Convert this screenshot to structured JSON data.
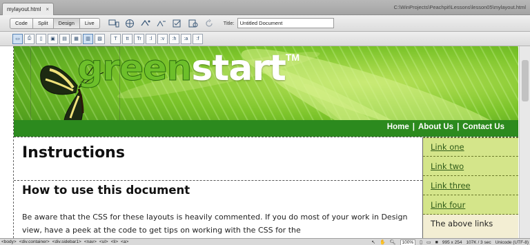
{
  "tab": {
    "filename": "mylayout.html",
    "close": "×"
  },
  "file_path": "C:\\WinProjects\\Peachpit\\Lessons\\lesson05\\mylayout.html",
  "doc_toolbar": {
    "code": "Code",
    "split": "Split",
    "design": "Design",
    "live": "Live",
    "title_label": "Title:",
    "title_value": "Untitled Document",
    "icons": [
      "multiscreen-icon",
      "preview-browser-icon",
      "file-management-icon",
      "visual-aids-icon",
      "validate-icon",
      "refresh-icon"
    ]
  },
  "style_toolbar": {
    "buttons": [
      "screen",
      "print",
      "handheld",
      "projection",
      "tty",
      "tv",
      "toggle-css",
      "design-time",
      "t",
      "tt",
      "T",
      ":l",
      ":v",
      ":h",
      ":a",
      ":f"
    ]
  },
  "header": {
    "logo_green": "green",
    "logo_start": "start",
    "logo_tm": "TM",
    "nav": [
      "Home",
      "About Us",
      "Contact Us"
    ],
    "nav_separator": "|"
  },
  "content": {
    "h1": "Instructions",
    "h2": "How to use this document",
    "paragraph": "Be aware that the CSS for these layouts is heavily commented. If you do most of your work in Design view, have a peek at the code to get tips on working with the CSS for the"
  },
  "sidebar": {
    "links": [
      "Link one",
      "Link two",
      "Link three",
      "Link four"
    ],
    "note": "The above links"
  },
  "statusbar": {
    "tags": [
      "<body>",
      "<div.container>",
      "<div.sidebar1>",
      "<nav>",
      "<ul>",
      "<li>",
      "<a>"
    ],
    "zoom": "100%",
    "dimensions": "995 x 254",
    "file_size": "107K / 3 sec",
    "encoding": "Unicode (UTF-8)"
  },
  "colors": {
    "nav_bar": "#2c8a1e",
    "sidebar_bg": "#d4e58a",
    "side_note_bg": "#f3eed3",
    "link_color": "#2e5a18"
  }
}
